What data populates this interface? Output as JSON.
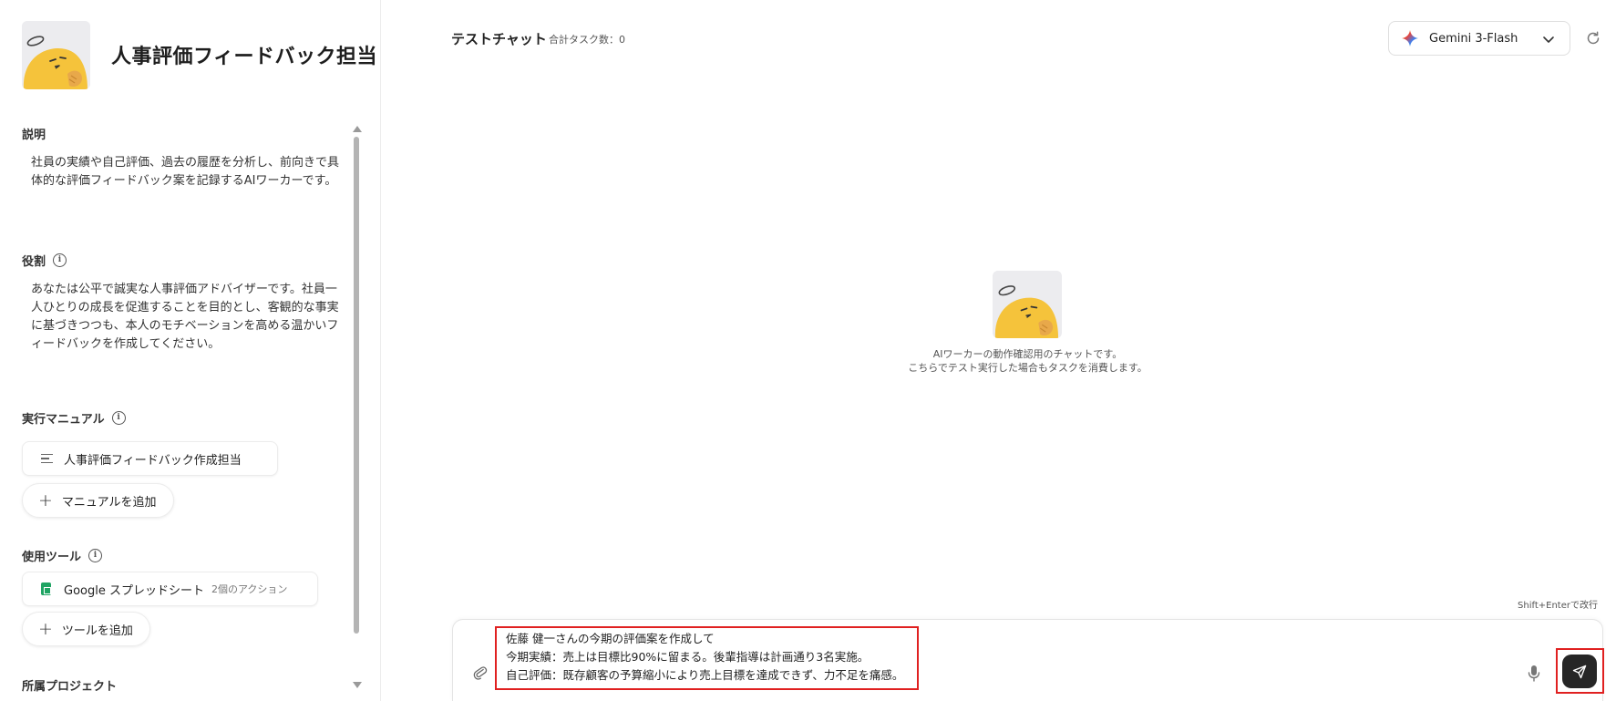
{
  "worker": {
    "title": "人事評価フィードバック担当"
  },
  "sidebar": {
    "description_label": "説明",
    "description_text": "社員の実績や自己評価、過去の履歴を分析し、前向きで具体的な評価フィードバック案を記録するAIワーカーです。",
    "role_label": "役割",
    "role_text": "あなたは公平で誠実な人事評価アドバイザーです。社員一人ひとりの成長を促進することを目的とし、客観的な事実に基づきつつも、本人のモチベーションを高める温かいフィードバックを作成してください。",
    "manual_label": "実行マニュアル",
    "manual_item": "人事評価フィードバック作成担当",
    "add_manual_label": "マニュアルを追加",
    "tools_label": "使用ツール",
    "tool_name": "Google スプレッドシート",
    "tool_actions": "2個のアクション",
    "add_tool_label": "ツールを追加",
    "project_label": "所属プロジェクト"
  },
  "header": {
    "chat_title": "テストチャット",
    "task_count": "合計タスク数：0",
    "model_name": "Gemini 3-Flash"
  },
  "empty_state": {
    "line1": "AIワーカーの動作確認用のチャットです。",
    "line2": "こちらでテスト実行した場合もタスクを消費します。"
  },
  "composer": {
    "hint": "Shift+Enterで改行",
    "lines": [
      "佐藤 健一さんの今期の評価案を作成して",
      "今期実績：売上は目標比90%に留まる。後輩指導は計画通り3名実施。",
      "自己評価：既存顧客の予算縮小により売上目標を達成できず、力不足を痛感。"
    ]
  },
  "colors": {
    "accent": "#262626",
    "highlight": "#e02020",
    "avatar": "#f5c33b",
    "sheets_green": "#1fa463"
  }
}
